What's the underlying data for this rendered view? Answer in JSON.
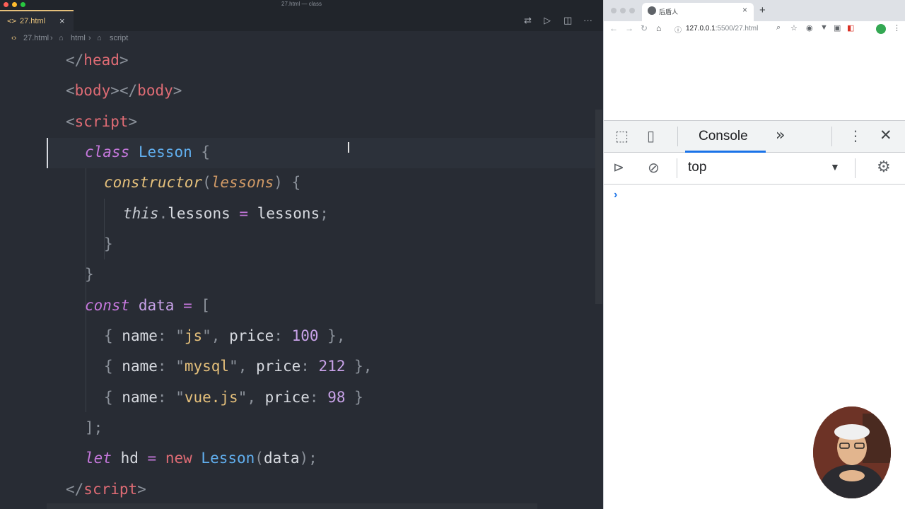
{
  "window": {
    "title": "27.html — class"
  },
  "editor": {
    "tab": {
      "label": "27.html",
      "icon": "<>"
    },
    "breadcrumb": [
      "27.html",
      "html",
      "script"
    ],
    "code_lines": [
      [
        [
          "t-punc",
          "</"
        ],
        [
          "t-tag",
          "head"
        ],
        [
          "t-punc",
          ">"
        ]
      ],
      [
        [
          "t-punc",
          "<"
        ],
        [
          "t-tag",
          "body"
        ],
        [
          "t-punc",
          "></"
        ],
        [
          "t-tag",
          "body"
        ],
        [
          "t-punc",
          ">"
        ]
      ],
      [
        [
          "t-punc",
          "<"
        ],
        [
          "t-tag",
          "script"
        ],
        [
          "t-punc",
          ">"
        ]
      ],
      [
        [
          "t-kw",
          "class"
        ],
        [
          "t-prop",
          " "
        ],
        [
          "t-cls",
          "Lesson"
        ],
        [
          "t-prop",
          " "
        ],
        [
          "t-punc",
          "{"
        ]
      ],
      [
        [
          "t-fn",
          "constructor"
        ],
        [
          "t-punc",
          "("
        ],
        [
          "t-param",
          "lessons"
        ],
        [
          "t-punc",
          ")"
        ],
        [
          "t-prop",
          " "
        ],
        [
          "t-punc",
          "{"
        ]
      ],
      [
        [
          "t-this",
          "this"
        ],
        [
          "t-punc",
          "."
        ],
        [
          "t-prop",
          "lessons"
        ],
        [
          "t-prop",
          " "
        ],
        [
          "t-op",
          "="
        ],
        [
          "t-prop",
          " lessons"
        ],
        [
          "t-punc",
          ";"
        ]
      ],
      [
        [
          "t-punc",
          "}"
        ]
      ],
      [
        [
          "t-punc",
          "}"
        ]
      ],
      [
        [
          "t-kw",
          "const"
        ],
        [
          "t-prop",
          " "
        ],
        [
          "t-var",
          "data"
        ],
        [
          "t-prop",
          " "
        ],
        [
          "t-op",
          "="
        ],
        [
          "t-prop",
          " "
        ],
        [
          "t-punc",
          "["
        ]
      ],
      [
        [
          "t-punc",
          "{"
        ],
        [
          "t-prop",
          " name"
        ],
        [
          "t-punc",
          ":"
        ],
        [
          "t-prop",
          " "
        ],
        [
          "t-punc",
          "\""
        ],
        [
          "t-str",
          "js"
        ],
        [
          "t-punc",
          "\""
        ],
        [
          "t-punc",
          ","
        ],
        [
          "t-prop",
          " price"
        ],
        [
          "t-punc",
          ":"
        ],
        [
          "t-prop",
          " "
        ],
        [
          "t-num",
          "100"
        ],
        [
          "t-prop",
          " "
        ],
        [
          "t-punc",
          "},"
        ]
      ],
      [
        [
          "t-punc",
          "{"
        ],
        [
          "t-prop",
          " name"
        ],
        [
          "t-punc",
          ":"
        ],
        [
          "t-prop",
          " "
        ],
        [
          "t-punc",
          "\""
        ],
        [
          "t-str",
          "mysql"
        ],
        [
          "t-punc",
          "\""
        ],
        [
          "t-punc",
          ","
        ],
        [
          "t-prop",
          " price"
        ],
        [
          "t-punc",
          ":"
        ],
        [
          "t-prop",
          " "
        ],
        [
          "t-num",
          "212"
        ],
        [
          "t-prop",
          " "
        ],
        [
          "t-punc",
          "},"
        ]
      ],
      [
        [
          "t-punc",
          "{"
        ],
        [
          "t-prop",
          " name"
        ],
        [
          "t-punc",
          ":"
        ],
        [
          "t-prop",
          " "
        ],
        [
          "t-punc",
          "\""
        ],
        [
          "t-str",
          "vue.js"
        ],
        [
          "t-punc",
          "\""
        ],
        [
          "t-punc",
          ","
        ],
        [
          "t-prop",
          " price"
        ],
        [
          "t-punc",
          ":"
        ],
        [
          "t-prop",
          " "
        ],
        [
          "t-num",
          "98"
        ],
        [
          "t-prop",
          " "
        ],
        [
          "t-punc",
          "}"
        ]
      ],
      [
        [
          "t-punc",
          "];"
        ]
      ],
      [
        [
          "t-kw",
          "let"
        ],
        [
          "t-prop",
          " hd "
        ],
        [
          "t-op",
          "="
        ],
        [
          "t-prop",
          " "
        ],
        [
          "t-new",
          "new"
        ],
        [
          "t-prop",
          " "
        ],
        [
          "t-cls",
          "Lesson"
        ],
        [
          "t-punc",
          "("
        ],
        [
          "t-prop",
          "data"
        ],
        [
          "t-punc",
          ");"
        ]
      ],
      [
        [
          "t-punc",
          "</"
        ],
        [
          "t-tag",
          "script"
        ],
        [
          "t-punc",
          ">"
        ]
      ]
    ]
  },
  "browser": {
    "tab_title": "后盾人",
    "url_host": "127.0.0.1",
    "url_path": ":5500/27.html",
    "devtools": {
      "active_tab": "Console",
      "more_tabs": "»",
      "context": "top",
      "prompt": "›"
    }
  },
  "colors": {
    "accent": "#1a73e8",
    "editor_bg": "#282c34",
    "tab_active": "#e5c07b"
  }
}
